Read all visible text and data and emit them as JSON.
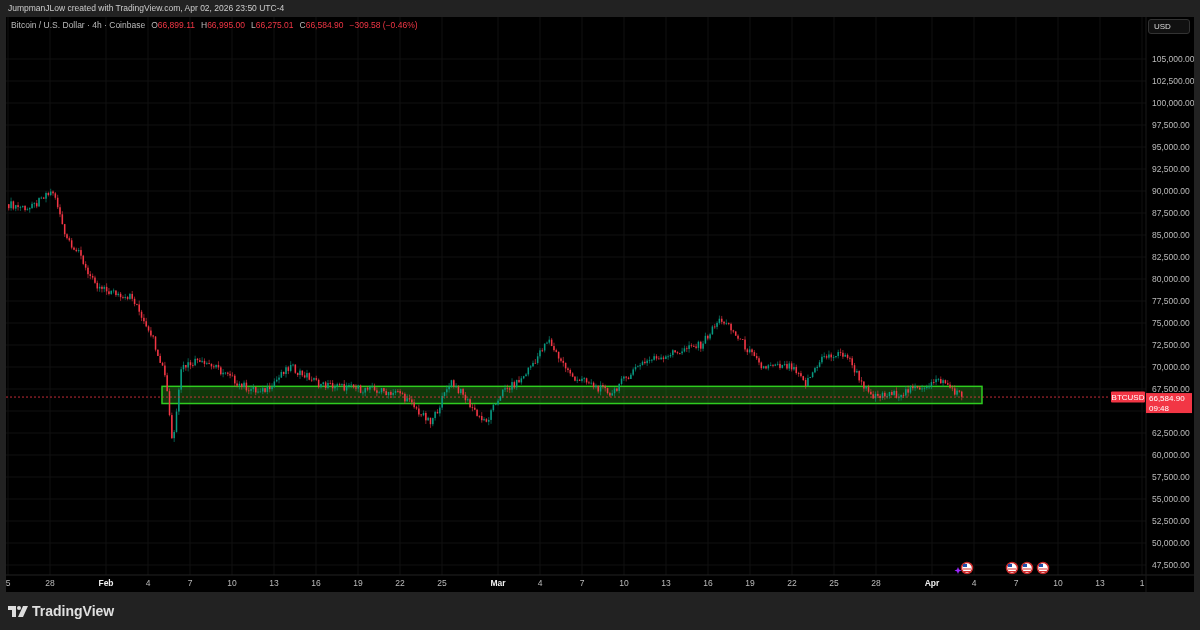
{
  "caption": "JumpmanJLow created with TradingView.com, Apr 02, 2026 23:50 UTC-4",
  "legend": {
    "symbol": "Bitcoin / U.S. Dollar · 4h · Coinbase",
    "ohlc": [
      {
        "label": "O",
        "value": "66,899.11"
      },
      {
        "label": "H",
        "value": "66,995.00"
      },
      {
        "label": "L",
        "value": "66,275.01"
      },
      {
        "label": "C",
        "value": "66,584.90"
      }
    ],
    "change": "−309.58 (−0.46%)"
  },
  "currency_button": "USD",
  "price_axis_upper": [
    "105,000.00",
    "102,500.00",
    "100,000.00",
    "97,500.00",
    "95,000.00",
    "92,500.00",
    "90,000.00",
    "87,500.00",
    "85,000.00",
    "82,500.00",
    "80,000.00",
    "77,500.00",
    "75,000.00",
    "72,500.00",
    "70,000.00",
    "67,500.00"
  ],
  "price_axis_lower": [
    "62,500.00",
    "60,000.00",
    "57,500.00",
    "55,000.00",
    "52,500.00",
    "50,000.00",
    "47,500.00"
  ],
  "time_axis": [
    {
      "label": "5",
      "kind": "day"
    },
    {
      "label": "28",
      "kind": "day"
    },
    {
      "label": "Feb",
      "kind": "month"
    },
    {
      "label": "4",
      "kind": "day"
    },
    {
      "label": "7",
      "kind": "day"
    },
    {
      "label": "10",
      "kind": "day"
    },
    {
      "label": "13",
      "kind": "day"
    },
    {
      "label": "16",
      "kind": "day"
    },
    {
      "label": "19",
      "kind": "day"
    },
    {
      "label": "22",
      "kind": "day"
    },
    {
      "label": "25",
      "kind": "day"
    },
    {
      "label": "Mar",
      "kind": "month"
    },
    {
      "label": "4",
      "kind": "day"
    },
    {
      "label": "7",
      "kind": "day"
    },
    {
      "label": "10",
      "kind": "day"
    },
    {
      "label": "13",
      "kind": "day"
    },
    {
      "label": "16",
      "kind": "day"
    },
    {
      "label": "19",
      "kind": "day"
    },
    {
      "label": "22",
      "kind": "day"
    },
    {
      "label": "25",
      "kind": "day"
    },
    {
      "label": "28",
      "kind": "day"
    },
    {
      "label": "Apr",
      "kind": "month"
    },
    {
      "label": "4",
      "kind": "day"
    },
    {
      "label": "7",
      "kind": "day"
    },
    {
      "label": "10",
      "kind": "day"
    },
    {
      "label": "13",
      "kind": "day"
    },
    {
      "label": "1",
      "kind": "day"
    }
  ],
  "price_marker": {
    "symbol": "BTCUSD",
    "price": "66,584.90",
    "countdown": "09:48"
  },
  "events": [
    {
      "kind": "sparkle"
    },
    {
      "kind": "flag"
    },
    {
      "kind": "flag"
    },
    {
      "kind": "flag"
    },
    {
      "kind": "flag"
    }
  ],
  "logo": "TradingView"
}
